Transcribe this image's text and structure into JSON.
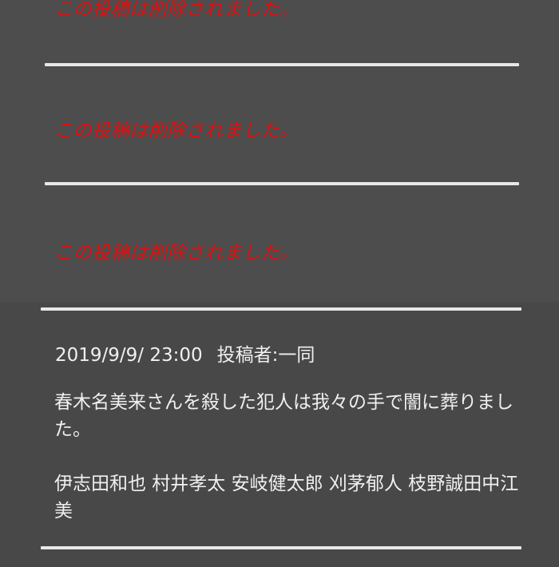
{
  "deleted_posts": [
    {
      "text": "この投稿は削除されました。"
    },
    {
      "text": "この投稿は削除されました。"
    },
    {
      "text": "この投稿は削除されました。"
    }
  ],
  "post": {
    "datetime": "2019/9/9/ 23:00",
    "author_label": "投稿者:",
    "author": "一同",
    "body": "春木名美来さんを殺した犯人は我々の手で闇に葬りました。",
    "signatures": "伊志田和也 村井孝太 安岐健太郎 刈茅郁人 枝野誠田中江美"
  },
  "colors": {
    "background": "#484848",
    "deleted_text": "#e00f0f",
    "divider": "#e8e8e8",
    "text": "#f0f0f0"
  }
}
